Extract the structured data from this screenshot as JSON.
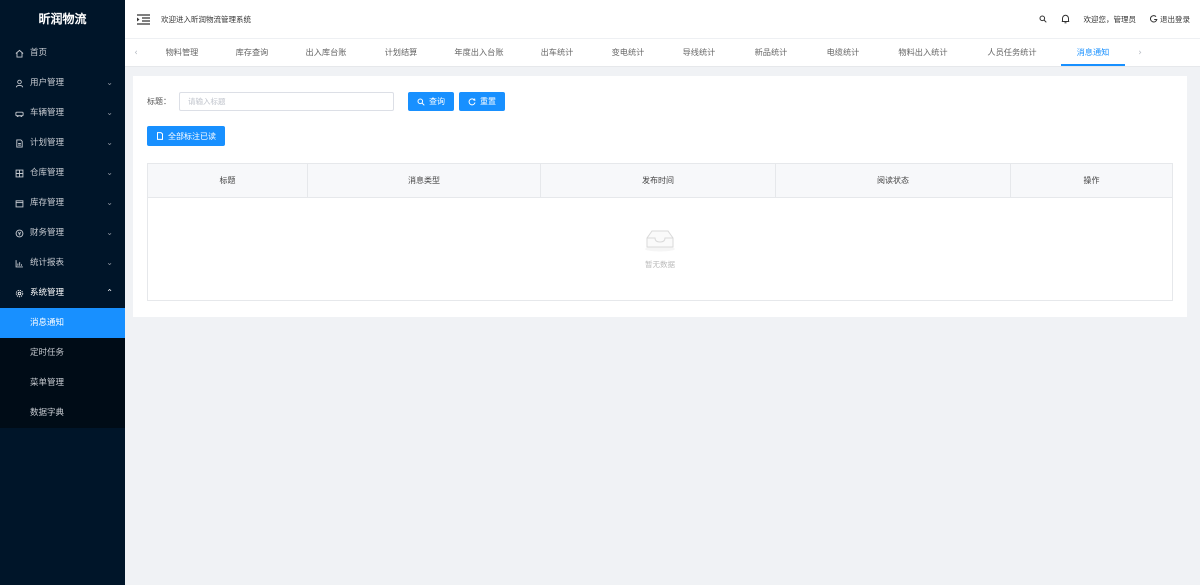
{
  "brand": "昕润物流",
  "header": {
    "welcome": "欢迎进入昕润物流管理系统",
    "greeting": "欢迎您，管理员",
    "logout": "退出登录"
  },
  "sidebar": {
    "items": [
      {
        "label": "首页",
        "icon": "home-icon"
      },
      {
        "label": "用户管理",
        "icon": "user-icon"
      },
      {
        "label": "车辆管理",
        "icon": "car-icon"
      },
      {
        "label": "计划管理",
        "icon": "document-icon"
      },
      {
        "label": "仓库管理",
        "icon": "warehouse-icon"
      },
      {
        "label": "库存管理",
        "icon": "inventory-icon"
      },
      {
        "label": "财务管理",
        "icon": "finance-icon"
      },
      {
        "label": "统计报表",
        "icon": "chart-icon"
      },
      {
        "label": "系统管理",
        "icon": "gear-icon"
      }
    ],
    "submenu": [
      {
        "label": "消息通知"
      },
      {
        "label": "定时任务"
      },
      {
        "label": "菜单管理"
      },
      {
        "label": "数据字典"
      }
    ]
  },
  "tabs": [
    {
      "label": "物料管理"
    },
    {
      "label": "库存查询"
    },
    {
      "label": "出入库台账"
    },
    {
      "label": "计划结算"
    },
    {
      "label": "年度出入台账"
    },
    {
      "label": "出车统计"
    },
    {
      "label": "变电统计"
    },
    {
      "label": "导线统计"
    },
    {
      "label": "新品统计"
    },
    {
      "label": "电缆统计"
    },
    {
      "label": "物料出入统计"
    },
    {
      "label": "人员任务统计"
    },
    {
      "label": "消息通知"
    }
  ],
  "search": {
    "label": "标题：",
    "placeholder": "请输入标题",
    "value": "",
    "search_button": "查询",
    "reset_button": "重置"
  },
  "mark_all_button": "全部标注已读",
  "table": {
    "columns": [
      "标题",
      "消息类型",
      "发布时间",
      "阅读状态",
      "操作"
    ],
    "empty_text": "暂无数据"
  },
  "colors": {
    "primary": "#1890ff",
    "sidebar_bg": "#001529",
    "submenu_bg": "#000c17"
  }
}
